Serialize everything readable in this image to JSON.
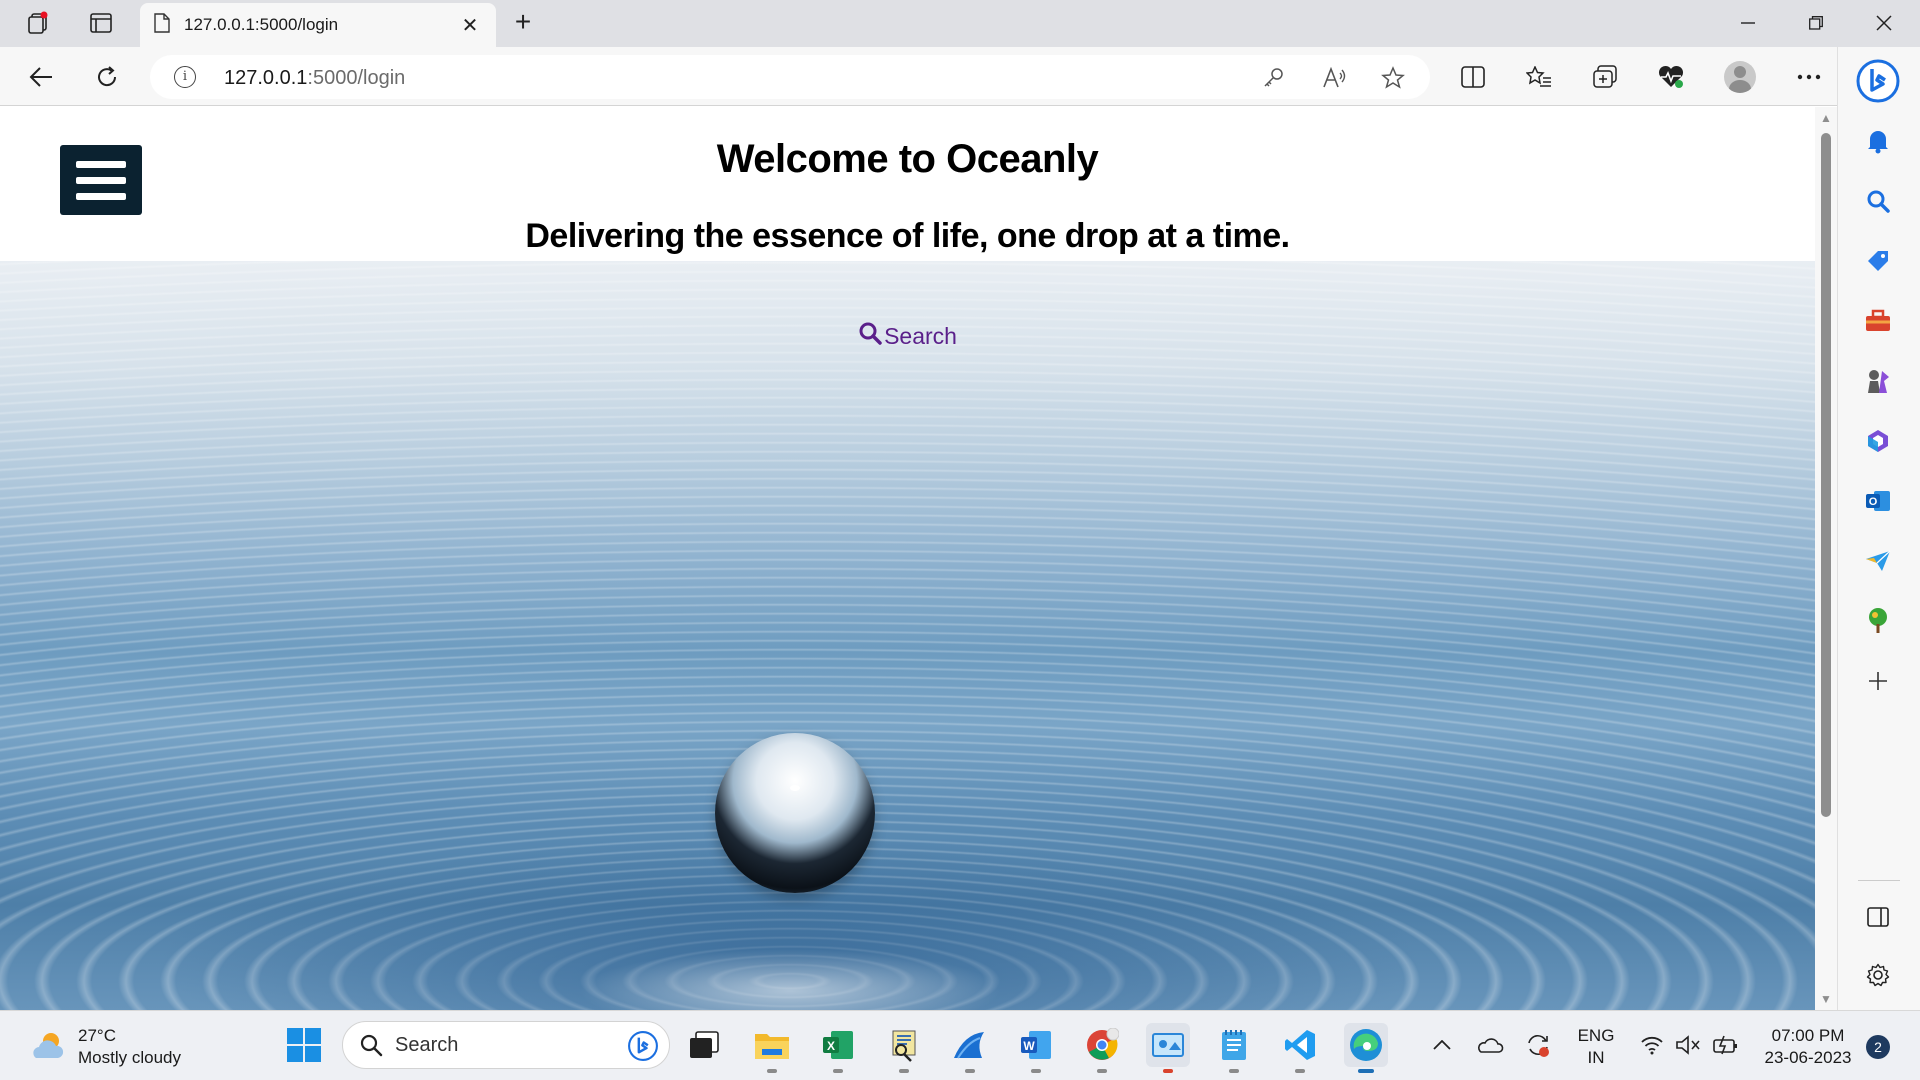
{
  "browser": {
    "tab_title": "127.0.0.1:5000/login",
    "url_host": "127.0.0.1",
    "url_rest": ":5000/login"
  },
  "page": {
    "title": "Welcome to Oceanly",
    "tagline": "Delivering the essence of life, one drop at a time.",
    "search_link": "Search",
    "link_color": "#5a1f8a",
    "menu_button_color": "#0b2230"
  },
  "taskbar": {
    "weather_temp": "27°C",
    "weather_desc": "Mostly cloudy",
    "search_label": "Search",
    "lang_primary": "ENG",
    "lang_secondary": "IN",
    "time": "07:00 PM",
    "date": "23-06-2023",
    "notification_count": "2"
  }
}
